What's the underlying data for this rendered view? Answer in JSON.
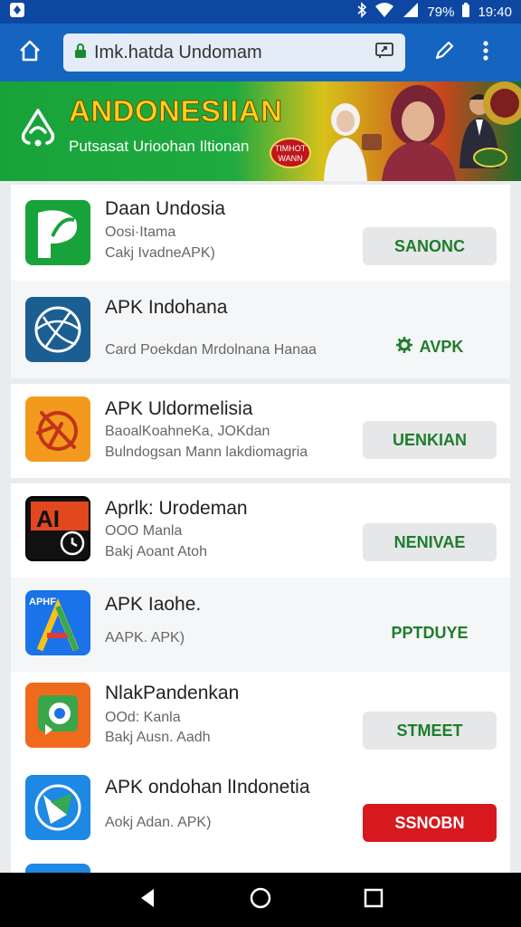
{
  "status": {
    "battery": "79%",
    "time": "19:40"
  },
  "browser": {
    "url": "Imk.hatda Undomam"
  },
  "banner": {
    "title": "ANDONESIIAN",
    "subtitle": "Putsasat Urioohan Iltionan",
    "badge": "TIMHOT WANN"
  },
  "apps": [
    {
      "name": "Daan Undosia",
      "line1": "Oosi·Itama",
      "line2": "Cakj IvadneAPK)",
      "action": "SANONC",
      "style": "gray"
    },
    {
      "name": "APK Indohana",
      "line1": "",
      "line2": "Card Poekdan Mrdolnana Hanaa",
      "action": "AVPK",
      "style": "plain-icon"
    },
    {
      "name": "APK Uldormelisia",
      "line1": "BaoalKoahneKa, JOKdan",
      "line2": "Bulndogsan Mann lakdiomagria",
      "action": "UENKIAN",
      "style": "gray"
    },
    {
      "name": "Aprlk: Urodeman",
      "line1": "OOO Manla",
      "line2": "Bakj Aoant Atoh",
      "action": "NENIVAE",
      "style": "gray"
    },
    {
      "name": "APK Iaohe.",
      "line1": "",
      "line2": "AAPK. APK)",
      "action": "PPTDUYE",
      "style": "plain"
    },
    {
      "name": "NlakPandenkan",
      "line1": "OOd: Kanla",
      "line2": "Bakj Ausn. Aadh",
      "action": "STMEET",
      "style": "gray"
    },
    {
      "name": "APK ondohan lIndonetia",
      "line1": "",
      "line2": "Aokj Adan. APK)",
      "action": "SSNOBN",
      "style": "red"
    }
  ],
  "icons": {
    "home": "home-icon",
    "lock": "lock-icon",
    "share": "share-icon",
    "edit": "pencil-icon",
    "menu": "more-vert-icon",
    "back": "back-triangle-icon",
    "home_nav": "home-circle-icon",
    "recents": "recents-square-icon"
  },
  "colors": {
    "toolbar": "#1565c0",
    "status": "#0d47a1",
    "action_text": "#1e7d2c",
    "action_red": "#d7191f"
  }
}
